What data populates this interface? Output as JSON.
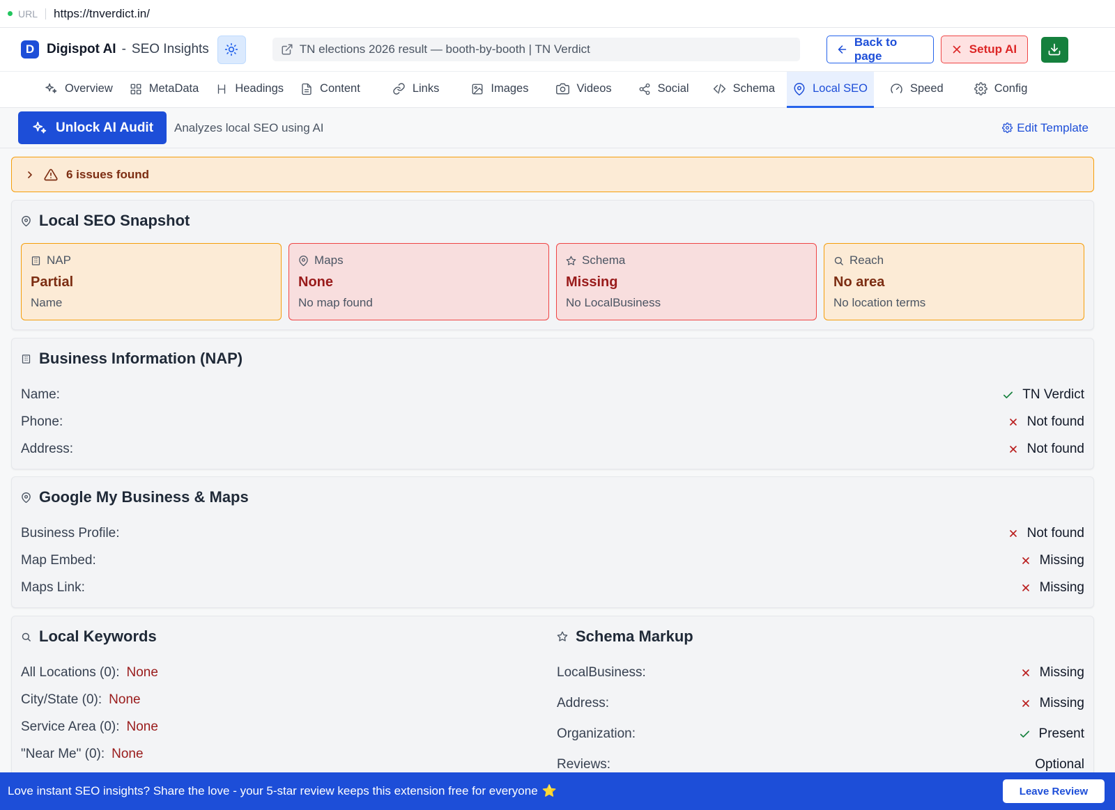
{
  "url_bar": {
    "label": "URL",
    "url": "https://tnverdict.in/"
  },
  "header": {
    "logo_letter": "D",
    "brand": "Digispot AI",
    "separator": "-",
    "subtitle": "SEO Insights",
    "page_title": "TN elections 2026 result — booth-by-booth | TN Verdict",
    "back_label": "Back to page",
    "setup_label": "Setup AI"
  },
  "tabs": [
    {
      "label": "Overview",
      "icon": "sparkle-icon"
    },
    {
      "label": "MetaData",
      "icon": "grid-icon"
    },
    {
      "label": "Headings",
      "icon": "heading-icon"
    },
    {
      "label": "Content",
      "icon": "document-icon"
    },
    {
      "label": "Links",
      "icon": "link-icon"
    },
    {
      "label": "Images",
      "icon": "image-icon"
    },
    {
      "label": "Videos",
      "icon": "camera-icon"
    },
    {
      "label": "Social",
      "icon": "share-icon"
    },
    {
      "label": "Schema",
      "icon": "code-icon"
    },
    {
      "label": "Local SEO",
      "icon": "map-pin-icon",
      "active": true
    },
    {
      "label": "Speed",
      "icon": "gauge-icon"
    },
    {
      "label": "Config",
      "icon": "gear-icon"
    }
  ],
  "ai_row": {
    "unlock_label": "Unlock AI Audit",
    "description": "Analyzes local SEO using AI",
    "edit_template_label": "Edit Template"
  },
  "issues": {
    "label": "6 issues found"
  },
  "snapshot": {
    "title": "Local SEO Snapshot",
    "boxes": [
      {
        "label": "NAP",
        "value": "Partial",
        "sub": "Name",
        "status": "warning",
        "icon": "building-icon"
      },
      {
        "label": "Maps",
        "value": "None",
        "sub": "No map found",
        "status": "error",
        "icon": "map-pin-icon"
      },
      {
        "label": "Schema",
        "value": "Missing",
        "sub": "No LocalBusiness",
        "status": "error",
        "icon": "star-icon"
      },
      {
        "label": "Reach",
        "value": "No area",
        "sub": "No location terms",
        "status": "warning",
        "icon": "search-icon"
      }
    ]
  },
  "nap": {
    "title": "Business Information (NAP)",
    "rows": [
      {
        "label": "Name:",
        "value": "TN Verdict",
        "ok": true
      },
      {
        "label": "Phone:",
        "value": "Not found",
        "ok": false
      },
      {
        "label": "Address:",
        "value": "Not found",
        "ok": false
      }
    ]
  },
  "gmb": {
    "title": "Google My Business & Maps",
    "rows": [
      {
        "label": "Business Profile:",
        "value": "Not found",
        "ok": false
      },
      {
        "label": "Map Embed:",
        "value": "Missing",
        "ok": false
      },
      {
        "label": "Maps Link:",
        "value": "Missing",
        "ok": false
      }
    ]
  },
  "keywords": {
    "title": "Local Keywords",
    "rows": [
      {
        "label": "All Locations (0):",
        "value": "None"
      },
      {
        "label": "City/State (0):",
        "value": "None"
      },
      {
        "label": "Service Area (0):",
        "value": "None"
      },
      {
        "label": "\"Near Me\" (0):",
        "value": "None"
      }
    ]
  },
  "schema_markup": {
    "title": "Schema Markup",
    "rows": [
      {
        "label": "LocalBusiness:",
        "value": "Missing",
        "ok": false
      },
      {
        "label": "Address:",
        "value": "Missing",
        "ok": false
      },
      {
        "label": "Organization:",
        "value": "Present",
        "ok": true
      },
      {
        "label": "Reviews:",
        "value": "Optional"
      }
    ]
  },
  "banner": {
    "text": "Love instant SEO insights? Share the love - your 5-star review keeps this extension free for everyone",
    "star": "⭐",
    "button_label": "Leave Review"
  },
  "colors": {
    "accent": "#1d4ed8",
    "warning_bg": "#fcebd6",
    "warning_border": "#f59e0b",
    "error_bg": "#f8dede",
    "error_border": "#ef4444",
    "success": "#15803d",
    "error_text": "#991b1b"
  }
}
